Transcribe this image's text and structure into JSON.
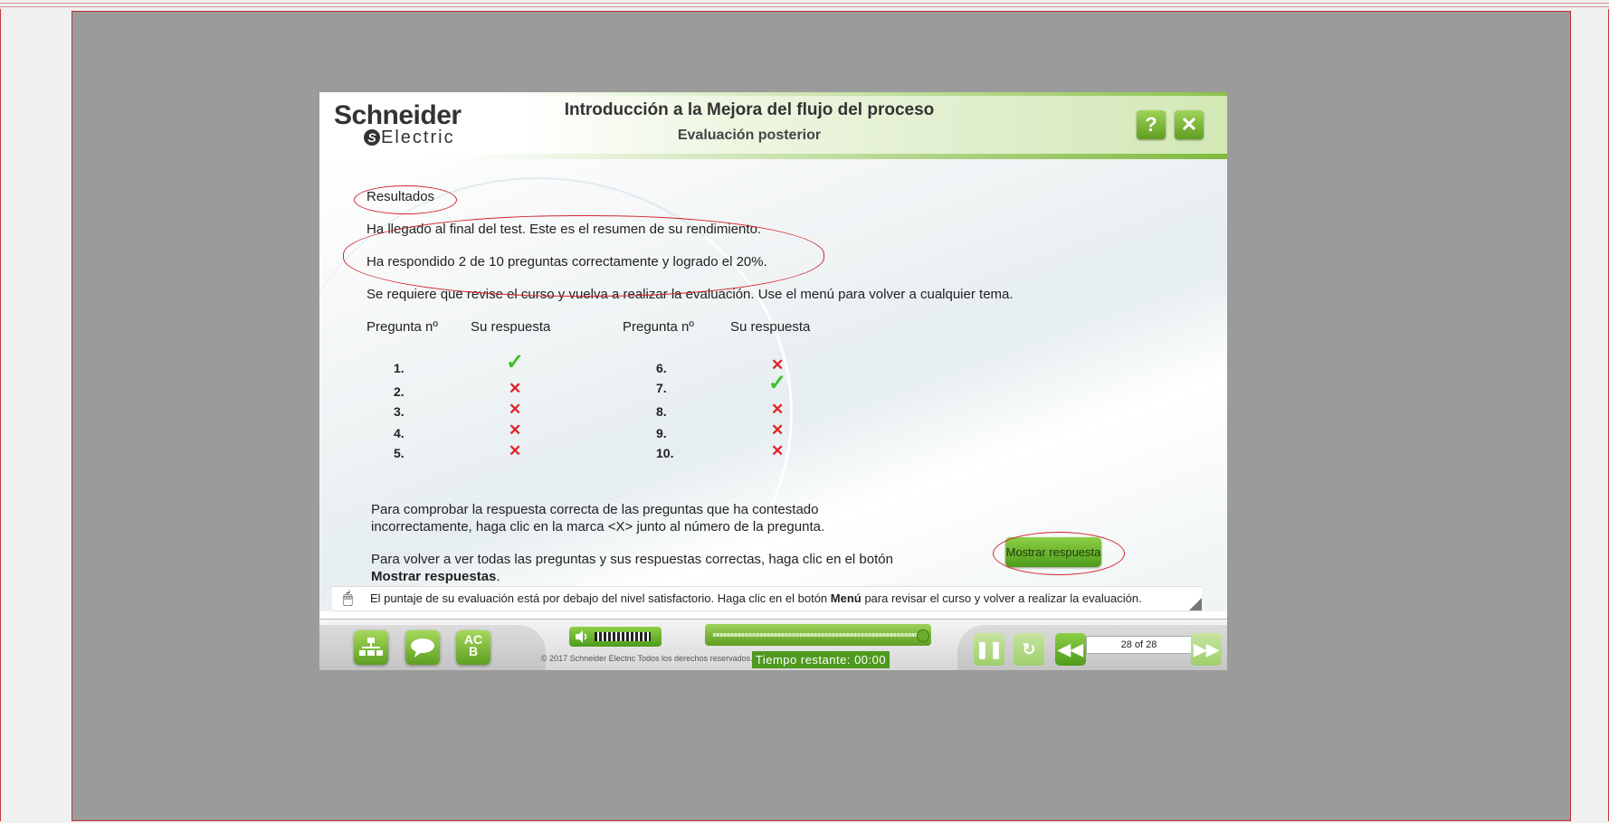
{
  "header": {
    "logo_top": "Schneider",
    "logo_bottom": "Electric",
    "logo_mark": "S",
    "title": "Introducción a la Mejora del flujo del proceso",
    "subtitle": "Evaluación posterior",
    "help_label": "?",
    "close_label": "✕"
  },
  "results": {
    "heading": "Resultados",
    "line1": "Ha llegado al final del test. Este es el resumen de su rendimiento.",
    "line2": "Ha respondido 2 de 10 preguntas correctamente y logrado el 20%.",
    "line3": "Se requiere que revise el curso y vuelva a realizar la evaluación. Use el menú para volver a cualquier tema.",
    "col_question": "Pregunta nº",
    "col_answer": "Su respuesta",
    "questions": [
      {
        "num": "1.",
        "correct": true
      },
      {
        "num": "2.",
        "correct": false
      },
      {
        "num": "3.",
        "correct": false
      },
      {
        "num": "4.",
        "correct": false
      },
      {
        "num": "5.",
        "correct": false
      },
      {
        "num": "6.",
        "correct": false
      },
      {
        "num": "7.",
        "correct": true
      },
      {
        "num": "8.",
        "correct": false
      },
      {
        "num": "9.",
        "correct": false
      },
      {
        "num": "10.",
        "correct": false
      }
    ],
    "check_glyph": "✓",
    "cross_glyph": "✕",
    "instr1_a": "Para comprobar la respuesta correcta de las preguntas que ha contestado",
    "instr1_b": "incorrectamente, haga clic en la marca <X> junto al número de la pregunta.",
    "instr2_a": "Para volver a ver todas las preguntas y sus respuestas correctas, haga clic en el botón",
    "instr2_b": "Mostrar respuestas",
    "instr2_c": ".",
    "show_button": "Mostrar respuesta"
  },
  "note": {
    "icon": "mouse-icon",
    "text_a": "El puntaje de su evaluación está por debajo del nivel satisfactorio. Haga clic en el botón ",
    "text_b": "Menú",
    "text_c": " para revisar el curso y volver a realizar la evaluación."
  },
  "footer": {
    "menu_icon": "sitemap-icon",
    "chat_icon": "speech-bubble-icon",
    "glossary_label_top": "AC",
    "glossary_label_bottom": "B",
    "volume_icon": "speaker-icon",
    "copyright": "© 2017 Schneider Electric Todos los derechos reservados.",
    "timer_label": "Tiempo restante:  00:00",
    "pause_icon": "pause-icon",
    "replay_icon": "replay-icon",
    "back_icon": "rewind-icon",
    "page": "28 of 28",
    "next_icon": "fast-forward-icon",
    "progress_fraction": 1.0
  },
  "colors": {
    "accent_green": "#6caf2b",
    "annotation_red": "#d3242b",
    "check_green": "#3fbf2a",
    "cross_red": "#e0242b"
  }
}
